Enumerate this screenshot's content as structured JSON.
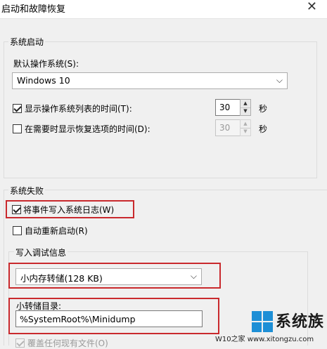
{
  "window": {
    "title": "启动和故障恢复",
    "close_glyph": "✕"
  },
  "system_startup": {
    "group_title": "系统启动",
    "default_os_label": "默认操作系统(S):",
    "default_os_value": "Windows 10",
    "show_list_label": "显示操作系统列表的时间(T):",
    "show_list_checked": true,
    "show_list_value": "30",
    "show_recovery_label": "在需要时显示恢复选项的时间(D):",
    "show_recovery_checked": false,
    "show_recovery_value": "30",
    "unit": "秒"
  },
  "system_failure": {
    "group_title": "系统失败",
    "write_event_label": "将事件写入系统日志(W)",
    "write_event_checked": true,
    "auto_restart_label": "自动重新启动(R)",
    "auto_restart_checked": false,
    "debug_info_title": "写入调试信息",
    "dump_type_value": "小内存转储(128 KB)",
    "dump_dir_label": "小转储目录:",
    "dump_dir_value": "%SystemRoot%\\Minidump",
    "overwrite_label": "覆盖任何现有文件(O)",
    "overwrite_checked": true
  },
  "watermark": {
    "brand_text": "系统族",
    "url": "W10之家  www.xitongzu.com"
  },
  "colors": {
    "highlight": "#c9292d",
    "background": "#f0f0f0",
    "windows_logo": "#1e8fd6"
  }
}
